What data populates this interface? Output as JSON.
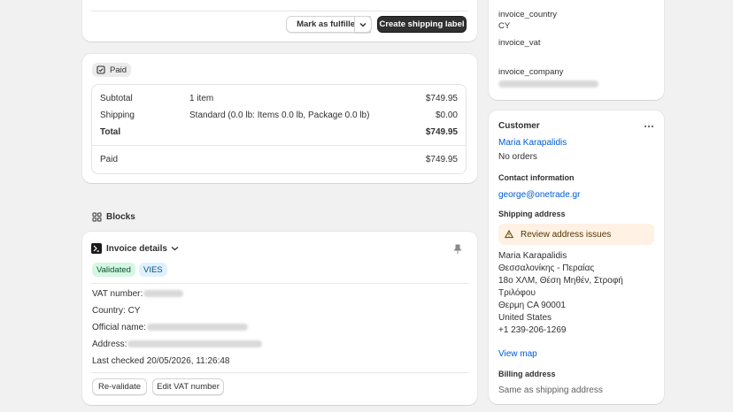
{
  "fulfillment": {
    "mark_fulfilled_label": "Mark as fulfilled",
    "create_label": "Create shipping label"
  },
  "payment": {
    "status_badge": "Paid",
    "rows": [
      {
        "label": "Subtotal",
        "desc": "1 item",
        "amount": "$749.95"
      },
      {
        "label": "Shipping",
        "desc": "Standard (0.0 lb: Items 0.0 lb, Package 0.0 lb)",
        "amount": "$0.00"
      },
      {
        "label": "Total",
        "desc": "",
        "amount": "$749.95"
      }
    ],
    "paid_label": "Paid",
    "paid_amount": "$749.95"
  },
  "blocks": {
    "title": "Blocks",
    "invoice": {
      "title": "Invoice details",
      "badge_validated": "Validated",
      "badge_vies": "VIES",
      "vat_label": "VAT number:",
      "country_label": "Country: CY",
      "official_name_label": "Official name:",
      "address_label": "Address:",
      "last_checked": "Last checked 20/05/2026, 11:26:48",
      "revalidate_label": "Re-validate",
      "edit_vat_label": "Edit VAT number"
    }
  },
  "metafields": {
    "country_key": "invoice_country",
    "country_value": "CY",
    "vat_key": "invoice_vat",
    "company_key": "invoice_company"
  },
  "customer": {
    "title": "Customer",
    "name": "Maria Karapalidis",
    "orders": "No orders",
    "contact_title": "Contact information",
    "email": "george@onetrade.gr",
    "shipping_title": "Shipping address",
    "warning": "Review address issues",
    "address_lines": [
      "Maria Karapalidis",
      "Θεσσαλονίκης - Περαίας",
      "18ο ΧΛΜ, Θέση Μηθέν, Στροφή",
      "Τριλόφου",
      "Θερμη CA 90001",
      "United States",
      "+1 239-206-1269"
    ],
    "view_map": "View map",
    "billing_title": "Billing address",
    "billing_value": "Same as shipping address"
  }
}
